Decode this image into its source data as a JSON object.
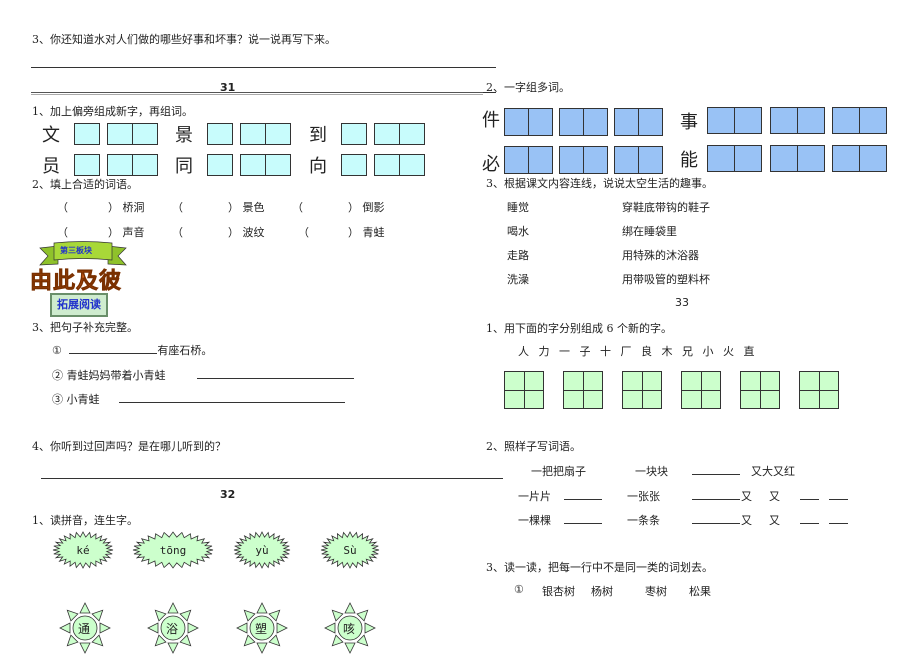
{
  "left": {
    "q3_water": "3、你还知道水对人们做的哪些好事和坏事？说一说再写下来。",
    "page31": "31",
    "q1_radical": {
      "title": "1、加上偏旁组成新字，再组词。",
      "chars": [
        "文",
        "景",
        "到",
        "员",
        "同",
        "向"
      ]
    },
    "q2_fill": {
      "title": "2、填上合适的词语。",
      "open": "（",
      "close": "）",
      "items": [
        "桥洞",
        "景色",
        "倒影",
        "声音",
        "波纹",
        "青蛙"
      ]
    },
    "banner": {
      "ribbon": "第三板块",
      "title": "由此及彼",
      "tag": "拓展阅读"
    },
    "q3_sentence": {
      "title": "3、把句子补充完整。",
      "items": [
        {
          "num": "①",
          "text": "有座石桥。"
        },
        {
          "num": "②",
          "text": "青蛙妈妈带着小青蛙"
        },
        {
          "num": "③",
          "text": "小青蛙"
        }
      ]
    },
    "q4_echo": "4、你听到过回声吗？是在哪儿听到的？",
    "page32": "32",
    "q1_pinyin": {
      "title": "1、读拼音，连生字。",
      "pinyin": [
        "ké",
        "tōng",
        "yù",
        "Sù"
      ],
      "chars": [
        "通",
        "浴",
        "塑",
        "咳"
      ]
    }
  },
  "right": {
    "q2_multi": {
      "title": "2、一字组多词。",
      "chars": [
        "件",
        "事",
        "必",
        "能"
      ]
    },
    "q3_space": {
      "title": "3、根据课文内容连线，说说太空生活的趣事。",
      "left_items": [
        "睡觉",
        "喝水",
        "走路",
        "洗澡"
      ],
      "right_items": [
        "穿鞋底带钩的鞋子",
        "绑在睡袋里",
        "用特殊的沐浴器",
        "用带吸管的塑料杯"
      ]
    },
    "page33": "33",
    "q1_compose": {
      "title": "1、用下面的字分别组成 6 个新的字。",
      "chars": [
        "人",
        "力",
        "一",
        "子",
        "十",
        "厂",
        "良",
        "木",
        "兄",
        "小",
        "火",
        "直"
      ]
    },
    "q2_pattern": {
      "title": "2、照样子写词语。",
      "example1": "一把把扇子",
      "example2": "一块块",
      "example3": "又大又红",
      "row2_a": "一片片",
      "row2_b": "一张张",
      "row3_a": "一棵棵",
      "row3_b": "一条条",
      "you": "又"
    },
    "q3_odd": {
      "title": "3、读一读，把每一行中不是同一类的词划去。",
      "num": "①",
      "words": [
        "银杏树",
        "杨树",
        "枣树",
        "松果"
      ]
    }
  },
  "colors": {
    "cyan_box": "#c8fcfc",
    "blue_box": "#99c2f5",
    "green_box": "#ccffcc",
    "banner_orange": "#f07020",
    "ribbon_green": "#99cc33",
    "ribbon_text": "#2233cc"
  }
}
